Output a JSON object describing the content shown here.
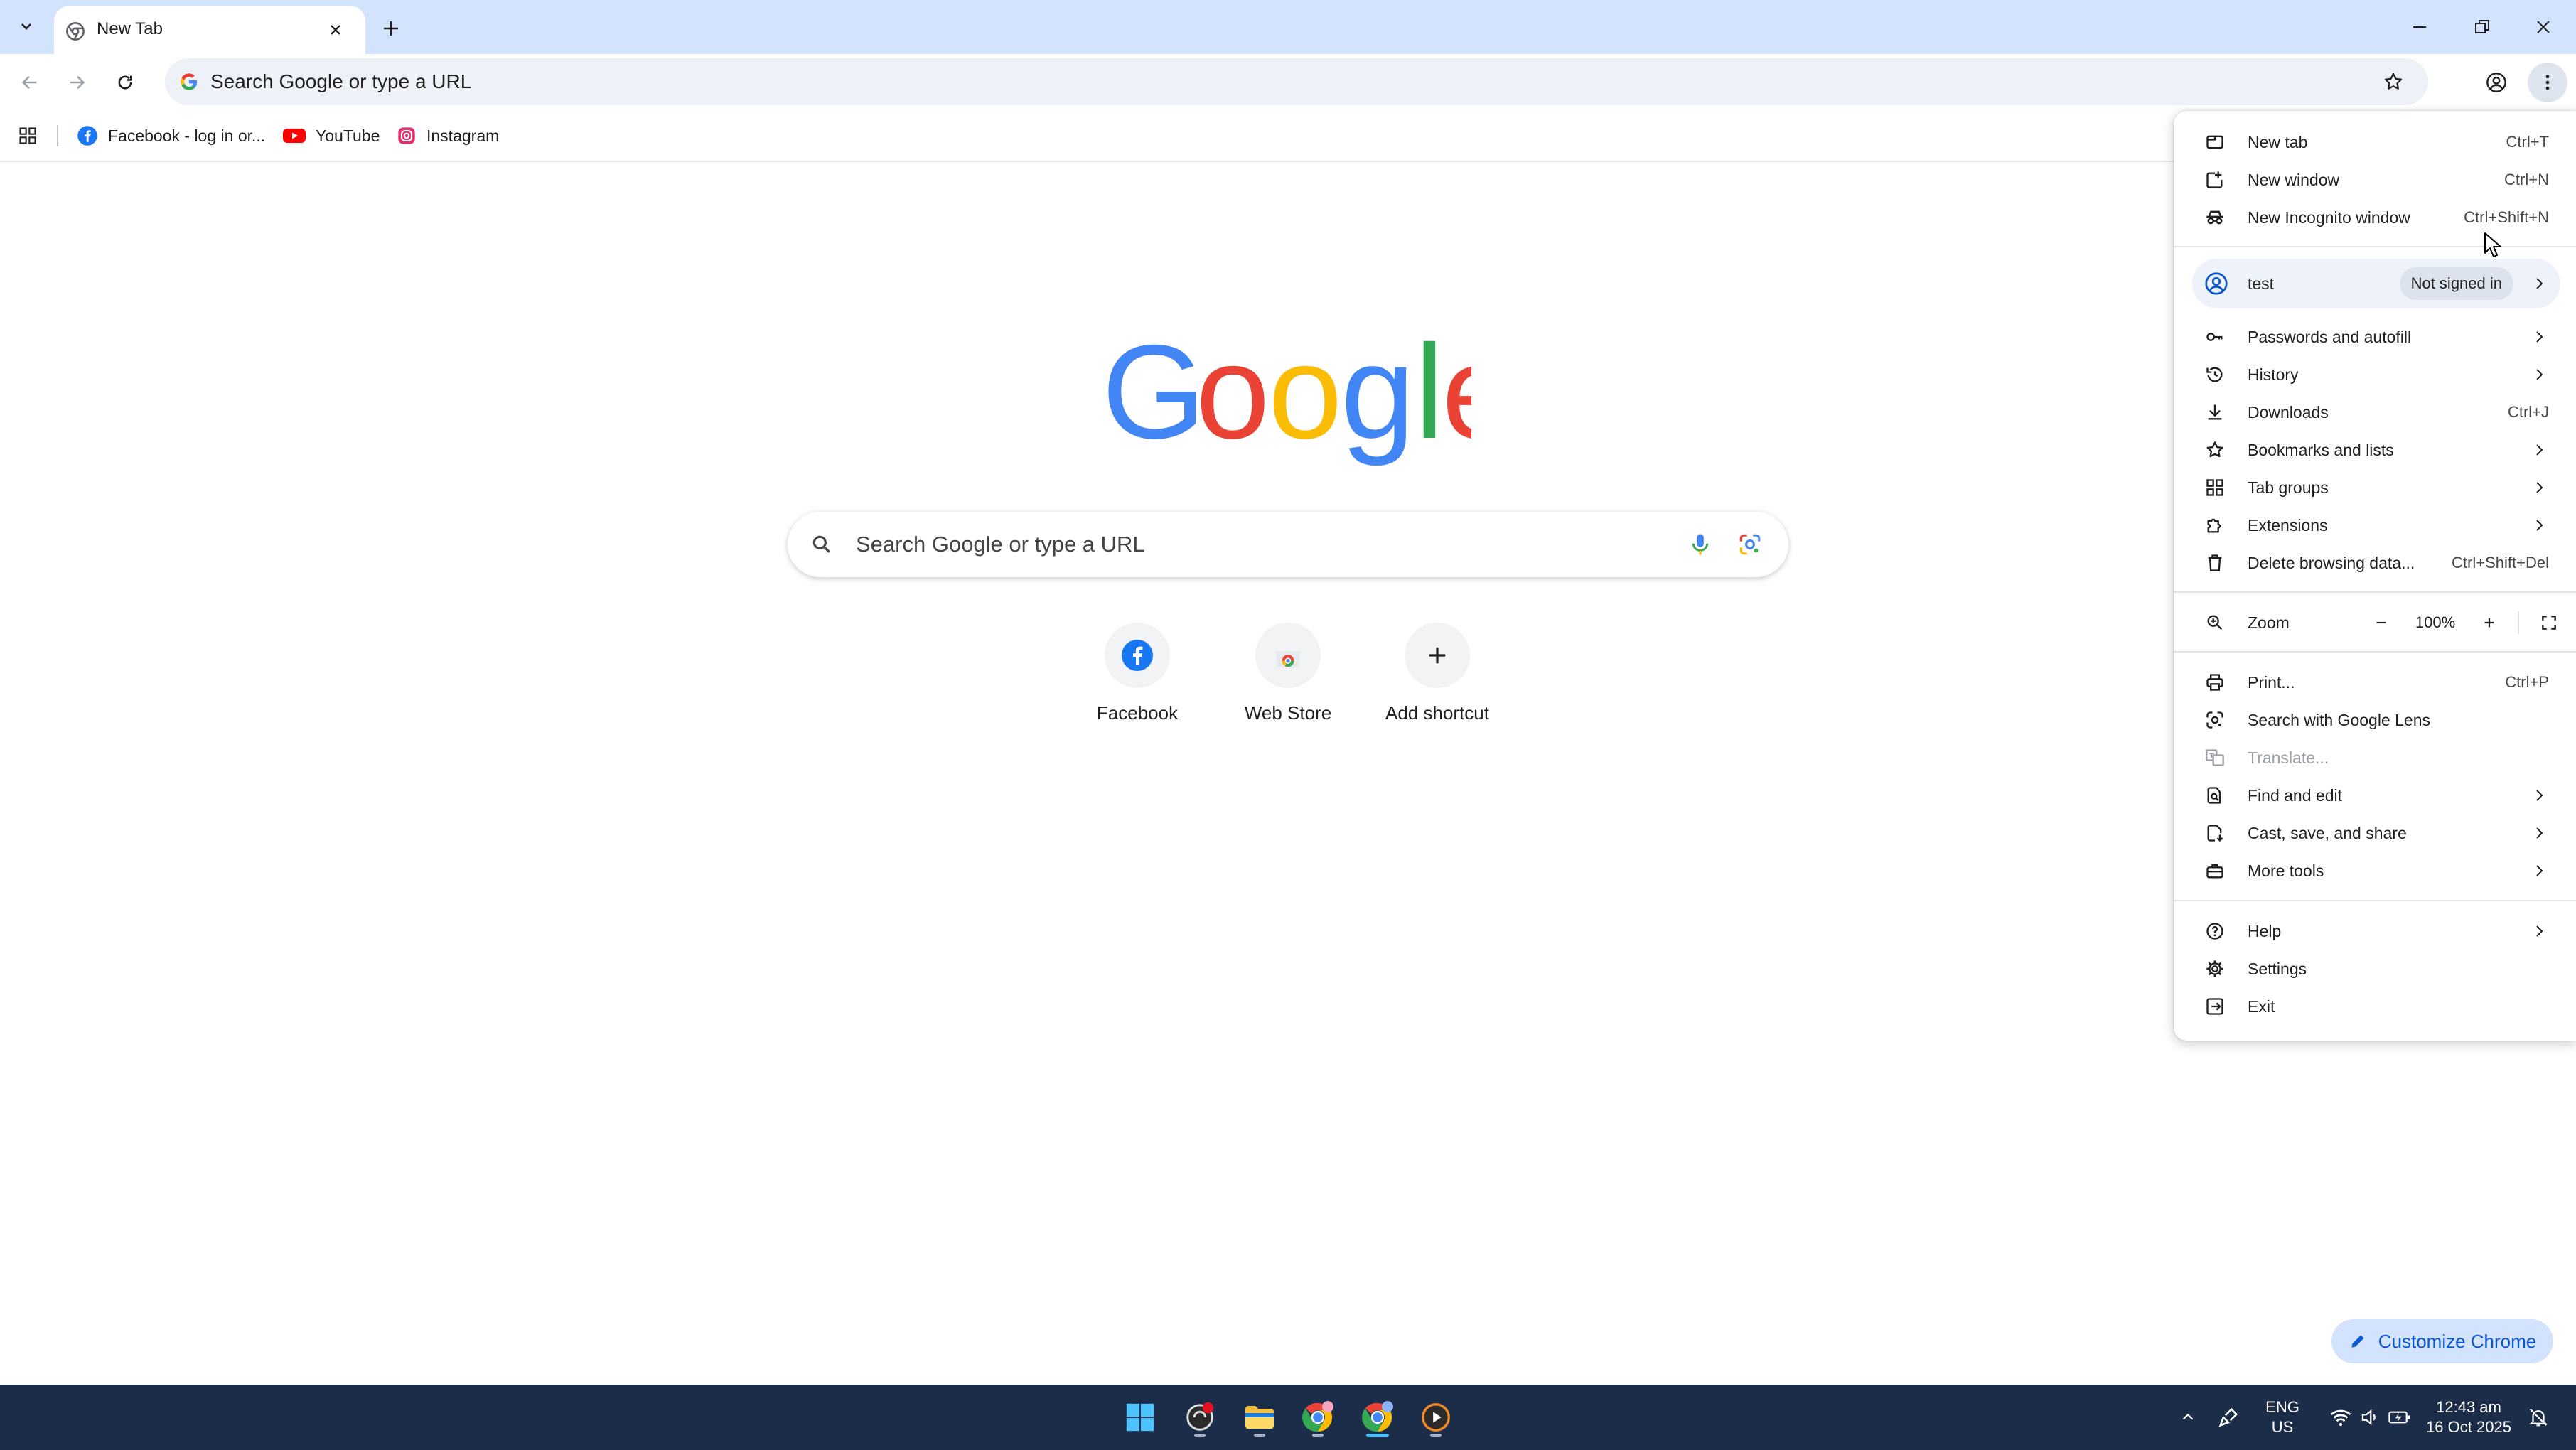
{
  "browser": {
    "tab": {
      "title": "New Tab"
    },
    "omnibox": {
      "placeholder": "Search Google or type a URL"
    },
    "bookmarks": [
      {
        "label": "Facebook - log in or...",
        "icon": "facebook-icon"
      },
      {
        "label": "YouTube",
        "icon": "youtube-icon"
      },
      {
        "label": "Instagram",
        "icon": "instagram-icon"
      }
    ]
  },
  "ntp": {
    "logo_letters": [
      "G",
      "o",
      "o",
      "g",
      "l",
      "e"
    ],
    "search_placeholder": "Search Google or type a URL",
    "shortcuts": [
      {
        "label": "Facebook",
        "icon": "facebook-icon"
      },
      {
        "label": "Web Store",
        "icon": "web-store-icon"
      },
      {
        "label": "Add shortcut",
        "icon": "plus-icon"
      }
    ],
    "customize_label": "Customize Chrome"
  },
  "menu": {
    "new_tab": {
      "label": "New tab",
      "shortcut": "Ctrl+T"
    },
    "new_window": {
      "label": "New window",
      "shortcut": "Ctrl+N"
    },
    "new_incognito": {
      "label": "New Incognito window",
      "shortcut": "Ctrl+Shift+N"
    },
    "profile": {
      "name": "test",
      "status": "Not signed in"
    },
    "passwords": {
      "label": "Passwords and autofill"
    },
    "history": {
      "label": "History"
    },
    "downloads": {
      "label": "Downloads",
      "shortcut": "Ctrl+J"
    },
    "bookmarks": {
      "label": "Bookmarks and lists"
    },
    "tab_groups": {
      "label": "Tab groups"
    },
    "extensions": {
      "label": "Extensions"
    },
    "delete_data": {
      "label": "Delete browsing data...",
      "shortcut": "Ctrl+Shift+Del"
    },
    "zoom": {
      "label": "Zoom",
      "level": "100%"
    },
    "print": {
      "label": "Print...",
      "shortcut": "Ctrl+P"
    },
    "lens": {
      "label": "Search with Google Lens"
    },
    "translate": {
      "label": "Translate..."
    },
    "find_edit": {
      "label": "Find and edit"
    },
    "cast_save": {
      "label": "Cast, save, and share"
    },
    "more_tools": {
      "label": "More tools"
    },
    "help": {
      "label": "Help"
    },
    "settings": {
      "label": "Settings"
    },
    "exit": {
      "label": "Exit"
    }
  },
  "taskbar": {
    "language": {
      "line1": "ENG",
      "line2": "US"
    },
    "clock": {
      "time": "12:43 am",
      "date": "16 Oct 2025"
    }
  },
  "colors": {
    "google_blue": "#4285F4",
    "google_red": "#EA4335",
    "google_yellow": "#FBBC05",
    "google_green": "#34A853",
    "tabstrip": "#d3e3fd",
    "taskbar": "#1c2d4a"
  }
}
